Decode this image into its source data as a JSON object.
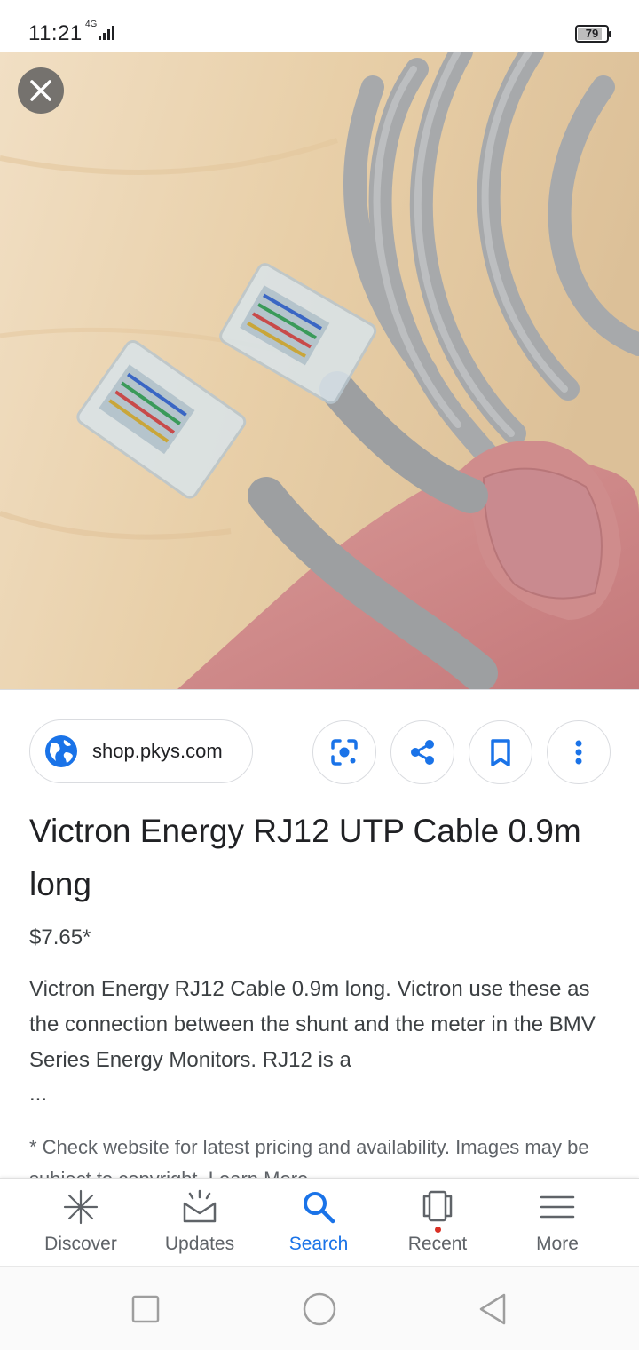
{
  "status_bar": {
    "time": "11:21",
    "network": "4G",
    "battery": "79",
    "battery_level": 0.79
  },
  "source": {
    "domain": "shop.pkys.com"
  },
  "product": {
    "title": "Victron Energy RJ12 UTP Cable 0.9m long",
    "price": "$7.65*",
    "description": "Victron Energy RJ12 Cable 0.9m long. Victron use these as the connection between the shunt and the meter in the BMV Series Energy Monitors. RJ12 is a",
    "ellipsis": "...",
    "disclaimer": "* Check website for latest pricing and availability. Images may be subject to copyright. Learn More"
  },
  "actions": {
    "lens_icon": "lens-icon",
    "share_icon": "share-icon",
    "bookmark_icon": "bookmark-icon",
    "more_icon": "more-vert-icon"
  },
  "bottom_nav": {
    "items": [
      {
        "label": "Discover",
        "icon": "discover-icon"
      },
      {
        "label": "Updates",
        "icon": "updates-icon"
      },
      {
        "label": "Search",
        "icon": "search-icon",
        "active": true
      },
      {
        "label": "Recent",
        "icon": "recent-icon"
      },
      {
        "label": "More",
        "icon": "menu-icon"
      }
    ]
  },
  "colors": {
    "accent": "#1a73e8",
    "text": "#202124",
    "secondary_text": "#5f6368",
    "notification_dot": "#d93025"
  }
}
